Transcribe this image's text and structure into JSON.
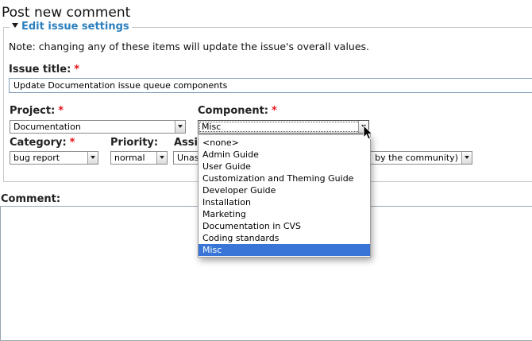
{
  "page": {
    "title": "Post new comment"
  },
  "issue_settings": {
    "legend": "Edit issue settings",
    "note": "Note: changing any of these items will update the issue's overall values.",
    "title_label": "Issue title:",
    "title_value": "Update Documentation issue queue components",
    "required_marker": "*",
    "project": {
      "label": "Project:",
      "value": "Documentation"
    },
    "component": {
      "label": "Component:",
      "value": "Misc",
      "options": [
        "<none>",
        "Admin Guide",
        "User Guide",
        "Customization and Theming Guide",
        "Developer Guide",
        "Installation",
        "Marketing",
        "Documentation in CVS",
        "Coding standards",
        "Misc"
      ],
      "selected_index": 9,
      "highlight_color": "#3875d7"
    },
    "category": {
      "label": "Category:",
      "value": "bug report"
    },
    "priority": {
      "label": "Priority:",
      "value": "normal"
    },
    "assigned": {
      "label": "Assi",
      "value": "Unas"
    },
    "status": {
      "value": "by the community)"
    }
  },
  "comment": {
    "label": "Comment:"
  },
  "colors": {
    "legend": "#2b7fbf",
    "required": "#e8111a",
    "selected_option": "#3875d7"
  }
}
